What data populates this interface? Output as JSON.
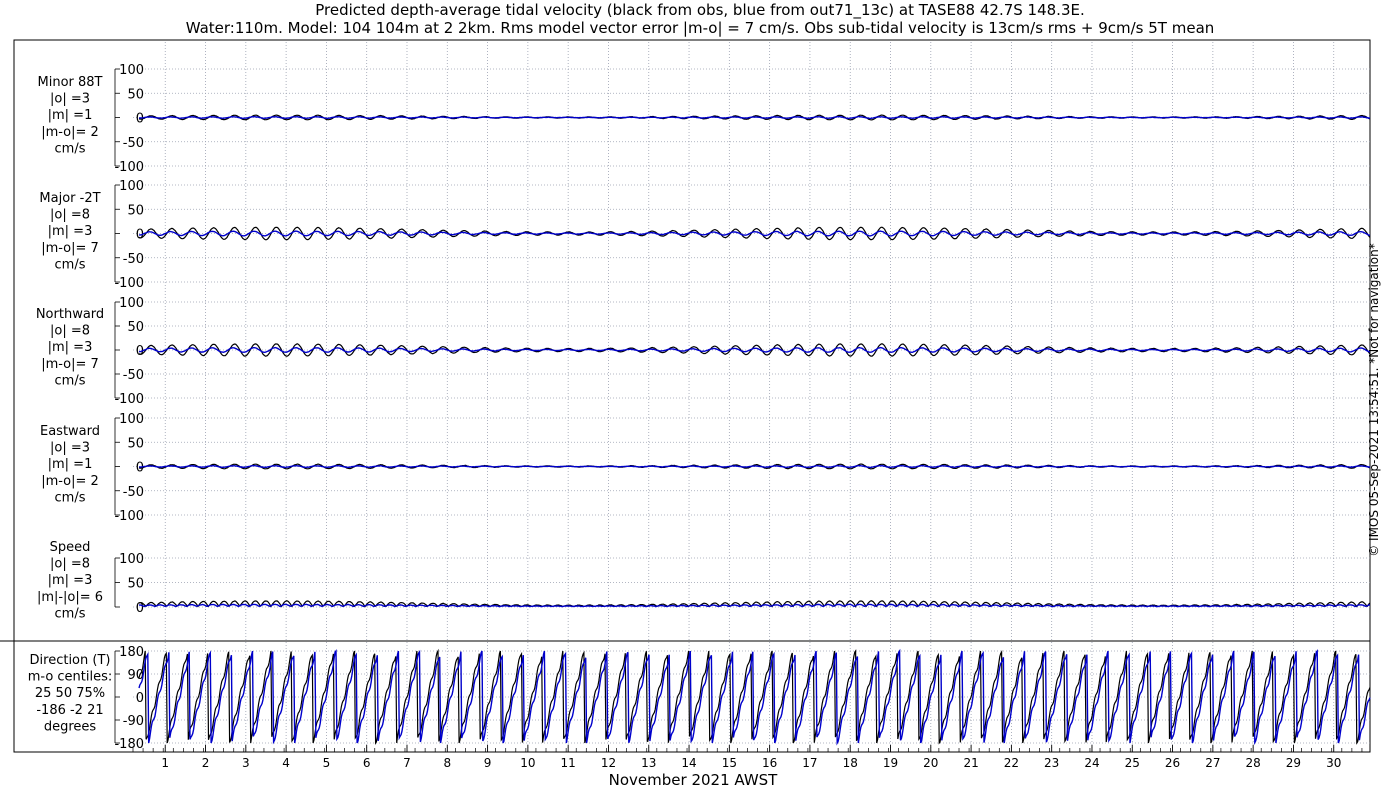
{
  "title": {
    "line1": "Predicted depth-average tidal velocity (black from obs, blue from out71_13c) at TASE88 42.7S 148.3E.",
    "line2": "Water:110m. Model: 104 104m at 2 2km. Rms model vector error |m-o| = 7 cm/s. Obs sub-tidal velocity is 13cm/s rms + 9cm/s 5T mean"
  },
  "copyright": "© IMOS 05-Sep-2021 13:54:51. *Not for navigation*",
  "xlabel": "November 2021 AWST",
  "colors": {
    "obs": "#000000",
    "model": "#0000cc",
    "grid": "#9aa0b0"
  },
  "chart_data": [
    {
      "type": "line",
      "panel": "minor",
      "labels": [
        "Minor 88T",
        "|o| =3",
        "|m| =1",
        "|m-o|= 2",
        "cm/s"
      ],
      "ylim": [
        -100,
        100
      ],
      "yticks": [
        "100",
        "50",
        "0",
        "-50",
        "-100"
      ],
      "ytick_values": [
        100,
        50,
        0,
        -50,
        -100
      ],
      "x": [
        1,
        30.9
      ],
      "series": [
        {
          "amplitude": 3
        },
        {
          "amplitude": 1
        }
      ]
    },
    {
      "type": "line",
      "panel": "major",
      "labels": [
        "Major -2T",
        "|o| =8",
        "|m| =3",
        "|m-o|= 7",
        "cm/s"
      ],
      "ylim": [
        -100,
        100
      ],
      "yticks": [
        "100",
        "50",
        "0",
        "-50",
        "-100"
      ],
      "ytick_values": [
        100,
        50,
        0,
        -50,
        -100
      ],
      "x": [
        1,
        30.9
      ],
      "series": [
        {
          "amplitude": 8
        },
        {
          "amplitude": 3
        }
      ]
    },
    {
      "type": "line",
      "panel": "northward",
      "labels": [
        "Northward",
        "|o| =8",
        "|m| =3",
        "|m-o|= 7",
        "cm/s"
      ],
      "ylim": [
        -100,
        100
      ],
      "yticks": [
        "100",
        "50",
        "0",
        "-50",
        "-100"
      ],
      "ytick_values": [
        100,
        50,
        0,
        -50,
        -100
      ],
      "x": [
        1,
        30.9
      ],
      "series": [
        {
          "amplitude": 8
        },
        {
          "amplitude": 3
        }
      ]
    },
    {
      "type": "line",
      "panel": "eastward",
      "labels": [
        "Eastward",
        "|o| =3",
        "|m| =1",
        "|m-o|= 2",
        "cm/s"
      ],
      "ylim": [
        -100,
        100
      ],
      "yticks": [
        "100",
        "50",
        "0",
        "-50",
        "-100"
      ],
      "ytick_values": [
        100,
        50,
        0,
        -50,
        -100
      ],
      "x": [
        1,
        30.9
      ],
      "series": [
        {
          "amplitude": 3
        },
        {
          "amplitude": 1
        }
      ]
    },
    {
      "type": "line",
      "panel": "speed",
      "labels": [
        "Speed",
        "|o| =8",
        "|m| =3",
        "|m|-|o|= 6",
        "cm/s"
      ],
      "ylim": [
        0,
        100
      ],
      "yticks": [
        "100",
        "50",
        "0"
      ],
      "ytick_values": [
        100,
        50,
        0
      ],
      "x": [
        1,
        30.9
      ],
      "series": [
        {
          "amplitude": 8
        },
        {
          "amplitude": 3
        }
      ]
    },
    {
      "type": "line",
      "panel": "direction",
      "labels": [
        "Direction (T)",
        "m-o centiles:",
        "25  50  75%",
        "-186   -2   21",
        "degrees"
      ],
      "ylim": [
        -180,
        180
      ],
      "yticks": [
        "180",
        "90",
        "0",
        "-90",
        "-180"
      ],
      "ytick_values": [
        180,
        90,
        0,
        -90,
        -180
      ],
      "x": [
        1,
        30.9
      ],
      "series": [
        {
          "phase_offset_deg": 0
        },
        {
          "phase_offset_deg": -2
        }
      ]
    }
  ],
  "xaxis": {
    "range": [
      0.2,
      30.9
    ],
    "ticks": [
      "1",
      "2",
      "3",
      "4",
      "5",
      "6",
      "7",
      "8",
      "9",
      "10",
      "11",
      "12",
      "13",
      "14",
      "15",
      "16",
      "17",
      "18",
      "19",
      "20",
      "21",
      "22",
      "23",
      "24",
      "25",
      "26",
      "27",
      "28",
      "29",
      "30"
    ],
    "tick_values": [
      1,
      2,
      3,
      4,
      5,
      6,
      7,
      8,
      9,
      10,
      11,
      12,
      13,
      14,
      15,
      16,
      17,
      18,
      19,
      20,
      21,
      22,
      23,
      24,
      25,
      26,
      27,
      28,
      29,
      30
    ],
    "minor_per_day": 4
  }
}
